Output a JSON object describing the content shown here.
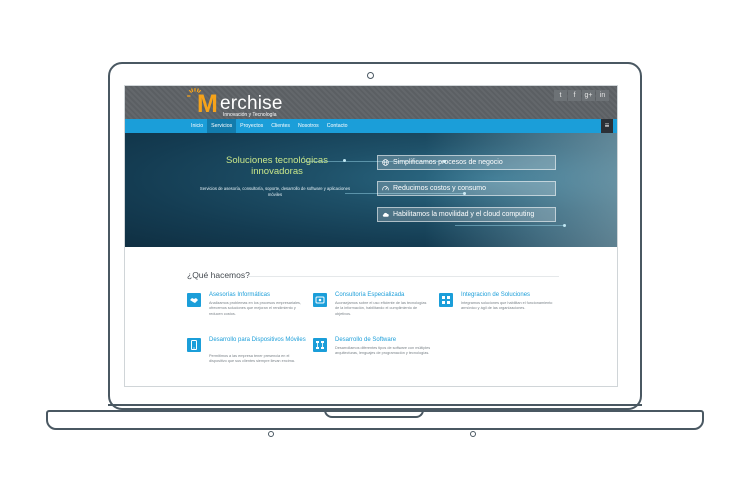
{
  "site": {
    "logo_m": "M",
    "logo_rest": "erchise",
    "logo_tagline": "Innovación y Tecnología"
  },
  "social": [
    {
      "icon": "twitter-icon",
      "glyph": "t"
    },
    {
      "icon": "facebook-icon",
      "glyph": "f"
    },
    {
      "icon": "google-plus-icon",
      "glyph": "g+"
    },
    {
      "icon": "linkedin-icon",
      "glyph": "in"
    }
  ],
  "nav": {
    "items": [
      "Inicio",
      "Servicios",
      "Proyectos",
      "Clientes",
      "Nosotros",
      "Contacto"
    ],
    "active": "Servicios",
    "menu_glyph": "≡"
  },
  "hero": {
    "title": "Soluciones tecnológicas innovadoras",
    "subtitle": "Servicios de asesoría, consultoría, soporte, desarrollo de software y aplicaciones móviles",
    "buttons": [
      {
        "label": "Simplificamos procesos de negocio",
        "icon": "globe-icon"
      },
      {
        "label": "Reducimos costos y consumo",
        "icon": "speedometer-icon"
      },
      {
        "label": "Habilitamos la movilidad y el cloud computing",
        "icon": "cloud-icon"
      }
    ]
  },
  "services": {
    "heading": "¿Qué hacemos?",
    "items": [
      {
        "title": "Asesorías Informáticas",
        "desc": "Analizamos problemas en los procesos empresariales, ofrecemos soluciones que mejoran el rendimiento y reducen costos.",
        "icon": "handshake-icon"
      },
      {
        "title": "Consultoría Especializada",
        "desc": "Aconsejamos sobre el uso eficiente de las tecnologías de la información, habilitando el cumplimiento de objetivos.",
        "icon": "consulting-icon"
      },
      {
        "title": "Integracion de Soluciones",
        "desc": "Integramos soluciones que habilitan el funcionamiento armónico y ágil de las organizaciones.",
        "icon": "integration-icon"
      },
      {
        "title": "Desarrollo para Dispositivos Móviles",
        "desc": "Permitimos a las empresa tener presencia en el dispositivo que sus clientes siempre llevan encima.",
        "icon": "mobile-icon"
      },
      {
        "title": "Desarrollo de Software",
        "desc": "Desarrollamos diferentes tipos de software con múltiples arquitecturas, lenguajes de programación y tecnologías.",
        "icon": "software-icon"
      }
    ]
  },
  "colors": {
    "accent": "#1b9ed9",
    "topbar": "#5b5f63",
    "logo_orange": "#f6a31a",
    "hero_title": "#c9e78a"
  }
}
